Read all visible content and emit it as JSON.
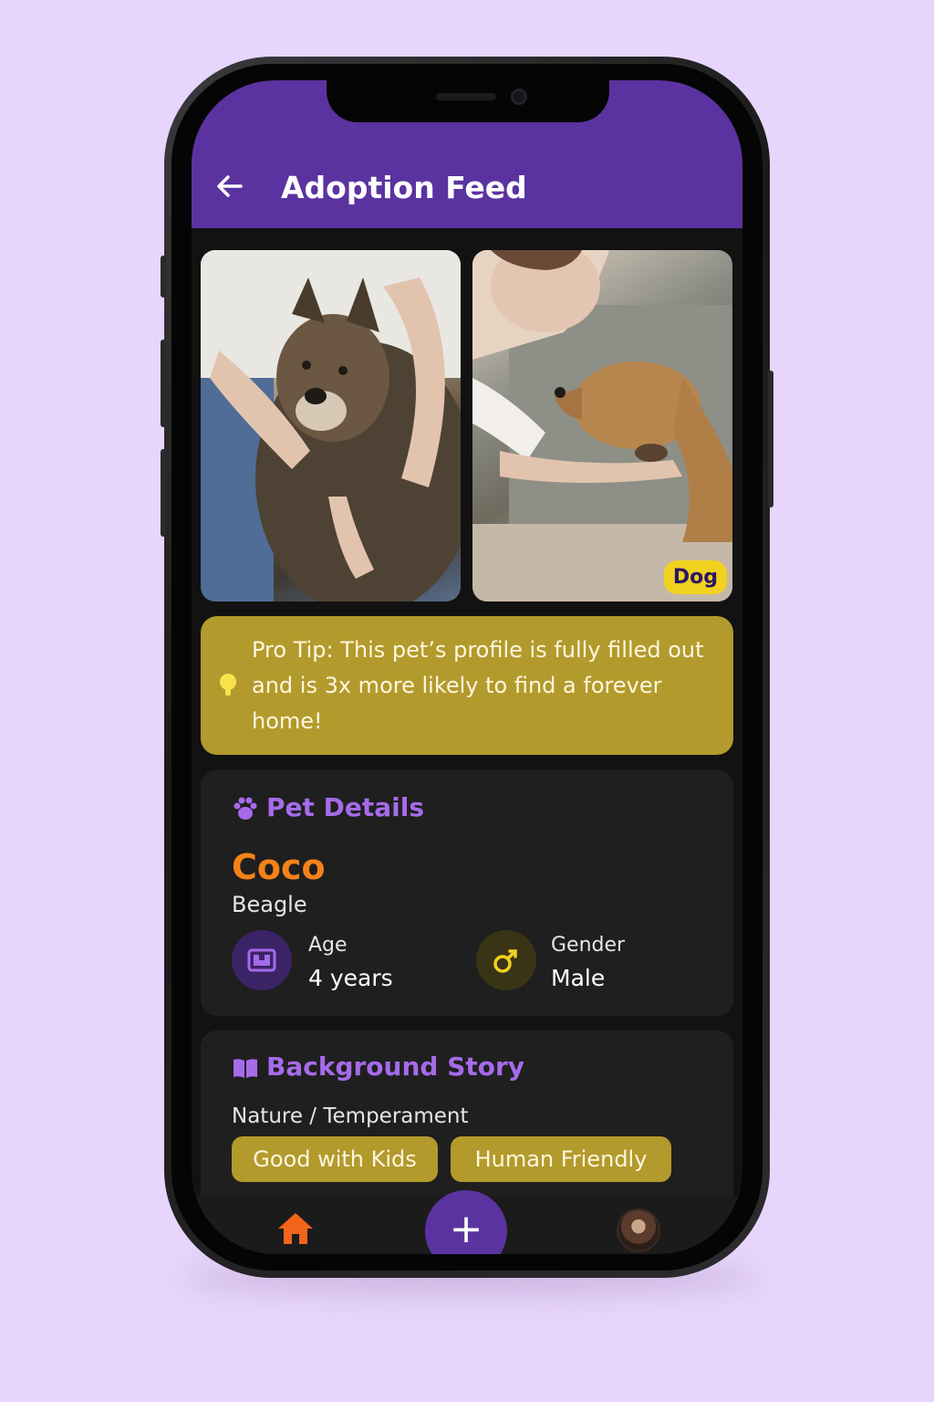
{
  "header": {
    "title": "Adoption Feed"
  },
  "photos": {
    "badge": "Dog"
  },
  "tip": {
    "text": "Pro Tip: This pet’s profile is fully filled out and is 3x more likely to find a forever home!"
  },
  "details": {
    "heading": "Pet Details",
    "name": "Coco",
    "breed": "Beagle",
    "age_label": "Age",
    "age_value": "4 years",
    "gender_label": "Gender",
    "gender_value": "Male"
  },
  "story": {
    "heading": "Background Story",
    "subheading": "Nature / Temperament",
    "tags": [
      "Good with Kids",
      "Human Friendly"
    ]
  },
  "nav": {
    "fab_label": "+"
  },
  "colors": {
    "accent": "#5b33a0",
    "highlight": "#f58219",
    "tip_bg": "#b39a2c",
    "badge": "#f1d21e"
  },
  "icons": {
    "back": "arrow-left-icon",
    "tip": "lightbulb-icon",
    "details": "paw-icon",
    "age": "calendar-icon",
    "gender": "male-symbol-icon",
    "story": "open-book-icon",
    "home": "home-icon"
  }
}
